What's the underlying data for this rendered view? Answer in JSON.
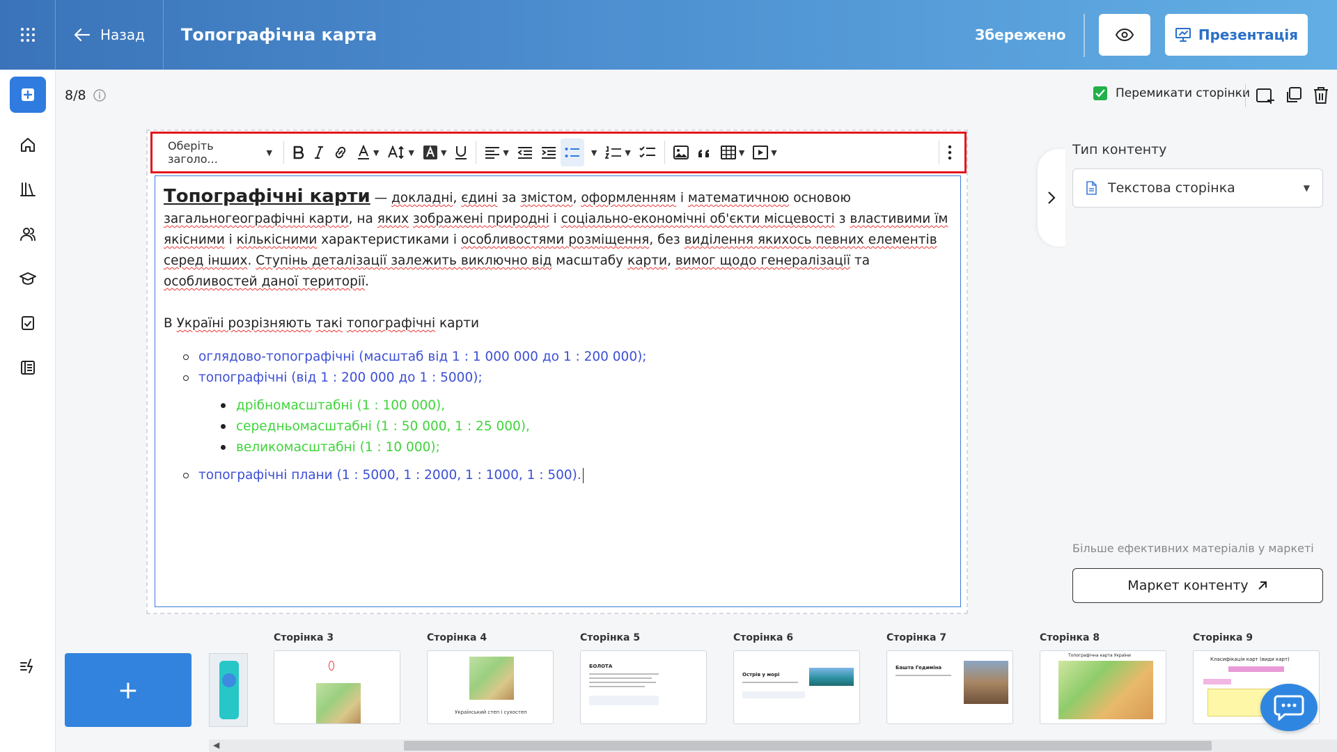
{
  "header": {
    "back_label": "Назад",
    "title": "Топографічна карта",
    "saved_label": "Збережено",
    "presentation_label": "Презентація"
  },
  "toolbar_top": {
    "page_counter": "8/8",
    "toggle_pages_label": "Перемикати сторінки"
  },
  "editor_toolbar": {
    "heading_placeholder": "Оберіть заголо..."
  },
  "content": {
    "lead_word": "Топографічні карти",
    "p1_rest": [
      {
        "t": " — ",
        "s": false
      },
      {
        "t": "докладні",
        "s": true
      },
      {
        "t": ", ",
        "s": false
      },
      {
        "t": "єдині",
        "s": true
      },
      {
        "t": " за ",
        "s": false
      },
      {
        "t": "змістом",
        "s": true
      },
      {
        "t": ", ",
        "s": false
      },
      {
        "t": "оформленням",
        "s": true
      },
      {
        "t": " і ",
        "s": false
      },
      {
        "t": "математичною",
        "s": true
      },
      {
        "t": " основою ",
        "s": false
      },
      {
        "t": "загальногеографічні карти",
        "s": true
      },
      {
        "t": ", на ",
        "s": false
      },
      {
        "t": "яких",
        "s": true
      },
      {
        "t": " ",
        "s": false
      },
      {
        "t": "зображені природні",
        "s": true
      },
      {
        "t": " і ",
        "s": false
      },
      {
        "t": "соціально-економічні об'єкти місцевості",
        "s": true
      },
      {
        "t": " з ",
        "s": false
      },
      {
        "t": "властивими їм якісними",
        "s": true
      },
      {
        "t": " і ",
        "s": false
      },
      {
        "t": "кількісними",
        "s": true
      },
      {
        "t": " характеристиками і ",
        "s": false
      },
      {
        "t": "особливостями розміщення",
        "s": true
      },
      {
        "t": ", без ",
        "s": false
      },
      {
        "t": "виділення якихось певних елементів серед інших",
        "s": true
      },
      {
        "t": ". ",
        "s": false
      },
      {
        "t": "Ступінь деталізації залежить виключно від",
        "s": true
      },
      {
        "t": " масштабу ",
        "s": false
      },
      {
        "t": "карти",
        "s": true
      },
      {
        "t": ", ",
        "s": false
      },
      {
        "t": "вимог щодо генералізації",
        "s": true
      },
      {
        "t": " та ",
        "s": false
      },
      {
        "t": "особливостей даної території",
        "s": true
      },
      {
        "t": ".",
        "s": false
      }
    ],
    "p2": [
      {
        "t": "В ",
        "s": false
      },
      {
        "t": "Україні розрізняють",
        "s": true
      },
      {
        "t": " ",
        "s": false
      },
      {
        "t": "такі",
        "s": true
      },
      {
        "t": " ",
        "s": false
      },
      {
        "t": "топографічні",
        "s": true
      },
      {
        "t": " карти",
        "s": false
      }
    ],
    "list1_a": "оглядово-топографічні (масштаб від 1 : 1 000 000 до 1 : 200 000);",
    "list1_b": "топографічні (від 1 : 200 000 до 1 : 5000);",
    "list2": [
      "дрібномасштабні (1 : 100 000),",
      "середньомасштабні (1 : 50 000, 1 : 25 000),",
      "великомасштабні (1 : 10 000);"
    ],
    "list1_c": "топографічні плани (1 : 5000, 1 : 2000, 1 : 1000, 1 : 500)."
  },
  "right_panel": {
    "content_type_label": "Тип контенту",
    "content_type_value": "Текстова сторінка",
    "more_materials": "Більше ефективних матеріалів у маркеті",
    "market_button": "Маркет контенту"
  },
  "pages": {
    "add_label": "+",
    "thumbnails": [
      {
        "label": "Сторінка 3"
      },
      {
        "label": "Сторінка 4",
        "caption": "Український степ і сухостеп"
      },
      {
        "label": "Сторінка 5",
        "heading": "БОЛОТА"
      },
      {
        "label": "Сторінка 6",
        "heading": "Острів у морі"
      },
      {
        "label": "Сторінка 7",
        "heading": "Башта Гедиміна"
      },
      {
        "label": "Сторінка 8",
        "heading": "Топографічна карта України"
      },
      {
        "label": "Сторінка 9",
        "heading": "Класифікація карт (види карт)"
      }
    ]
  },
  "colors": {
    "accent": "#2f7be0",
    "list_blue": "#3c4fd6",
    "list_green": "#3fd43a",
    "toolbar_highlight": "#e3151b"
  }
}
